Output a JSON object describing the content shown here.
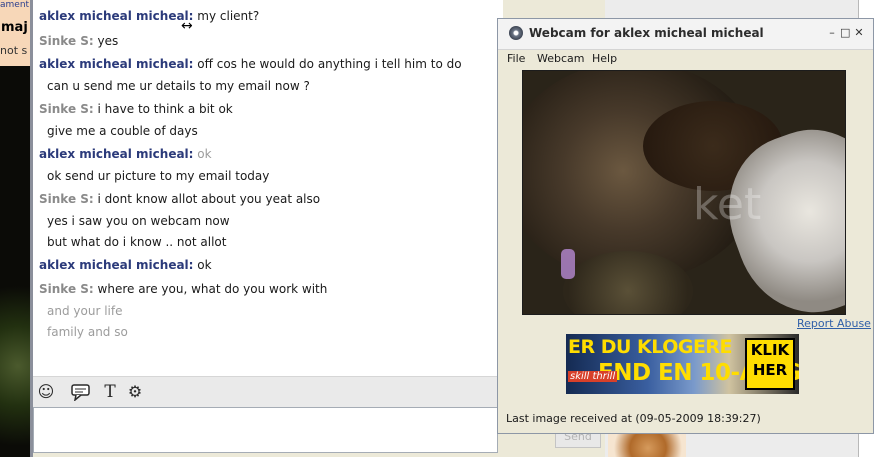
{
  "left_strip": {
    "fragment1": "ament",
    "fragment2": "maj",
    "fragment3": "not s"
  },
  "chat": {
    "messages": [
      {
        "sender": "aklex micheal micheal:",
        "text": " my client?"
      },
      {
        "sender": "Sinke S:",
        "text": " yes"
      },
      {
        "sender": "aklex micheal micheal:",
        "text": " off cos he would do anything i tell him to do"
      },
      {
        "text": "can u send me ur details to my email now ?"
      },
      {
        "sender": "Sinke S:",
        "text": " i have to think a bit ok"
      },
      {
        "text": "give me a couble of days"
      },
      {
        "sender": "aklex micheal micheal:",
        "text": " ok"
      },
      {
        "text": "ok send ur picture to my email today"
      },
      {
        "sender": "Sinke S:",
        "text": " i dont know allot about you yeat also"
      },
      {
        "text": "yes i saw you on webcam now"
      },
      {
        "text": "but what do i know .. not allot"
      },
      {
        "sender": "aklex micheal micheal:",
        "text": " ok"
      },
      {
        "sender": "Sinke S:",
        "text": " where are you, what do you work with"
      },
      {
        "text": "and your life"
      },
      {
        "text": "family and so"
      }
    ]
  },
  "toolbar": {
    "icons": [
      "emoticon-icon",
      "chat-bubble-icon",
      "text-format-icon",
      "settings-icon"
    ]
  },
  "send_button": "Send",
  "webcam_window": {
    "title": "Webcam for aklex micheal micheal",
    "menu": [
      "File",
      "Webcam",
      "Help"
    ],
    "watermark": "ket",
    "report_abuse": "Report Abuse",
    "status": "Last image received at (09-05-2009 18:39:27)",
    "ad": {
      "line1": "ER DU KLOGERE",
      "line2": "END EN 10-ÅRIG?",
      "brand": "skill thrill",
      "cta": "KLIK HER"
    }
  },
  "colors": {
    "sender_blue": "#2b3a7a",
    "sender_grey": "#8a8a8a",
    "ad_yellow": "#ffdd00",
    "link_blue": "#2f5fa8"
  }
}
